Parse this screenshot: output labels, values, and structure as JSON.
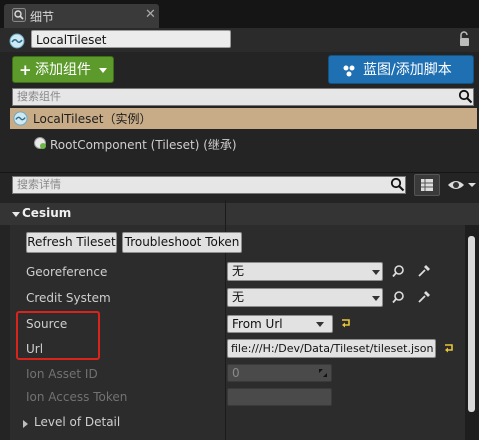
{
  "tab": {
    "title": "细节",
    "icon": "details-search-icon"
  },
  "header": {
    "object_name": "LocalTileset",
    "lock_icon": "lock-open-icon"
  },
  "toolbar": {
    "add_component_plus": "+",
    "add_component_label": "添加组件",
    "blueprint_label": "蓝图/添加脚本",
    "add_component_color": "#5c9a2b",
    "blueprint_color": "#1f6fb3"
  },
  "component_search": {
    "placeholder": "搜索组件"
  },
  "tree": {
    "selected": "LocalTileset（实例）",
    "selected_color": "#c8ac87",
    "child": "RootComponent (Tileset) (继承)"
  },
  "details_search": {
    "placeholder": "搜索详情"
  },
  "category": {
    "name": "Cesium"
  },
  "buttons": {
    "refresh": "Refresh Tileset",
    "troubleshoot": "Troubleshoot Token"
  },
  "properties": {
    "georeference": {
      "label": "Georeference",
      "value": "无"
    },
    "credit_system": {
      "label": "Credit System",
      "value": "无"
    },
    "source": {
      "label": "Source",
      "value": "From Url"
    },
    "url": {
      "label": "Url",
      "value": "file:///H:/Dev/Data/Tileset/tileset.json"
    },
    "ion_asset_id": {
      "label": "Ion Asset ID",
      "value": "0"
    },
    "ion_access_token": {
      "label": "Ion Access Token",
      "value": ""
    }
  },
  "subcategory": {
    "lod": "Level of Detail"
  },
  "highlight_color": "#d9241b"
}
